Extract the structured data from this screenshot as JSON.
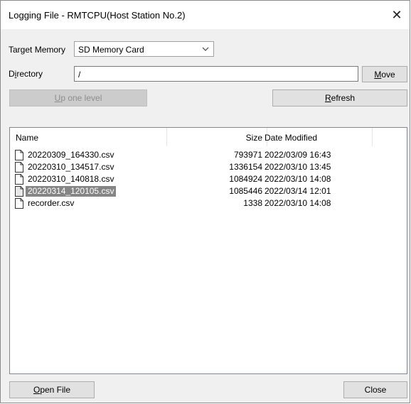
{
  "window": {
    "title": "Logging File - RMTCPU(Host Station No.2)",
    "close_glyph": "✕"
  },
  "target_memory": {
    "label_pre": "Tar",
    "label_accel": "g",
    "label_post": "et Memory",
    "selected": "SD Memory Card"
  },
  "directory": {
    "label_pre": "D",
    "label_accel": "i",
    "label_post": "rectory",
    "value": "/"
  },
  "buttons": {
    "move_accel": "M",
    "move_rest": "ove",
    "up_accel": "U",
    "up_rest": "p one level",
    "refresh_accel": "R",
    "refresh_rest": "efresh",
    "open_accel": "O",
    "open_rest": "pen File",
    "close": "Close"
  },
  "table": {
    "columns": [
      "Name",
      "Size",
      "Date Modified"
    ],
    "rows": [
      {
        "name": "20220309_164330.csv",
        "size": "793971",
        "date": "2022/03/09 16:43",
        "selected": false
      },
      {
        "name": "20220310_134517.csv",
        "size": "1336154",
        "date": "2022/03/10 13:45",
        "selected": false
      },
      {
        "name": "20220310_140818.csv",
        "size": "1084924",
        "date": "2022/03/10 14:08",
        "selected": false
      },
      {
        "name": "20220314_120105.csv",
        "size": "1085446",
        "date": "2022/03/14 12:01",
        "selected": true
      },
      {
        "name": "recorder.csv",
        "size": "1338",
        "date": "2022/03/10 14:08",
        "selected": false
      }
    ]
  },
  "icons": {
    "file": "file-icon",
    "dropdown": "chevron-down-icon",
    "close": "close-icon"
  }
}
